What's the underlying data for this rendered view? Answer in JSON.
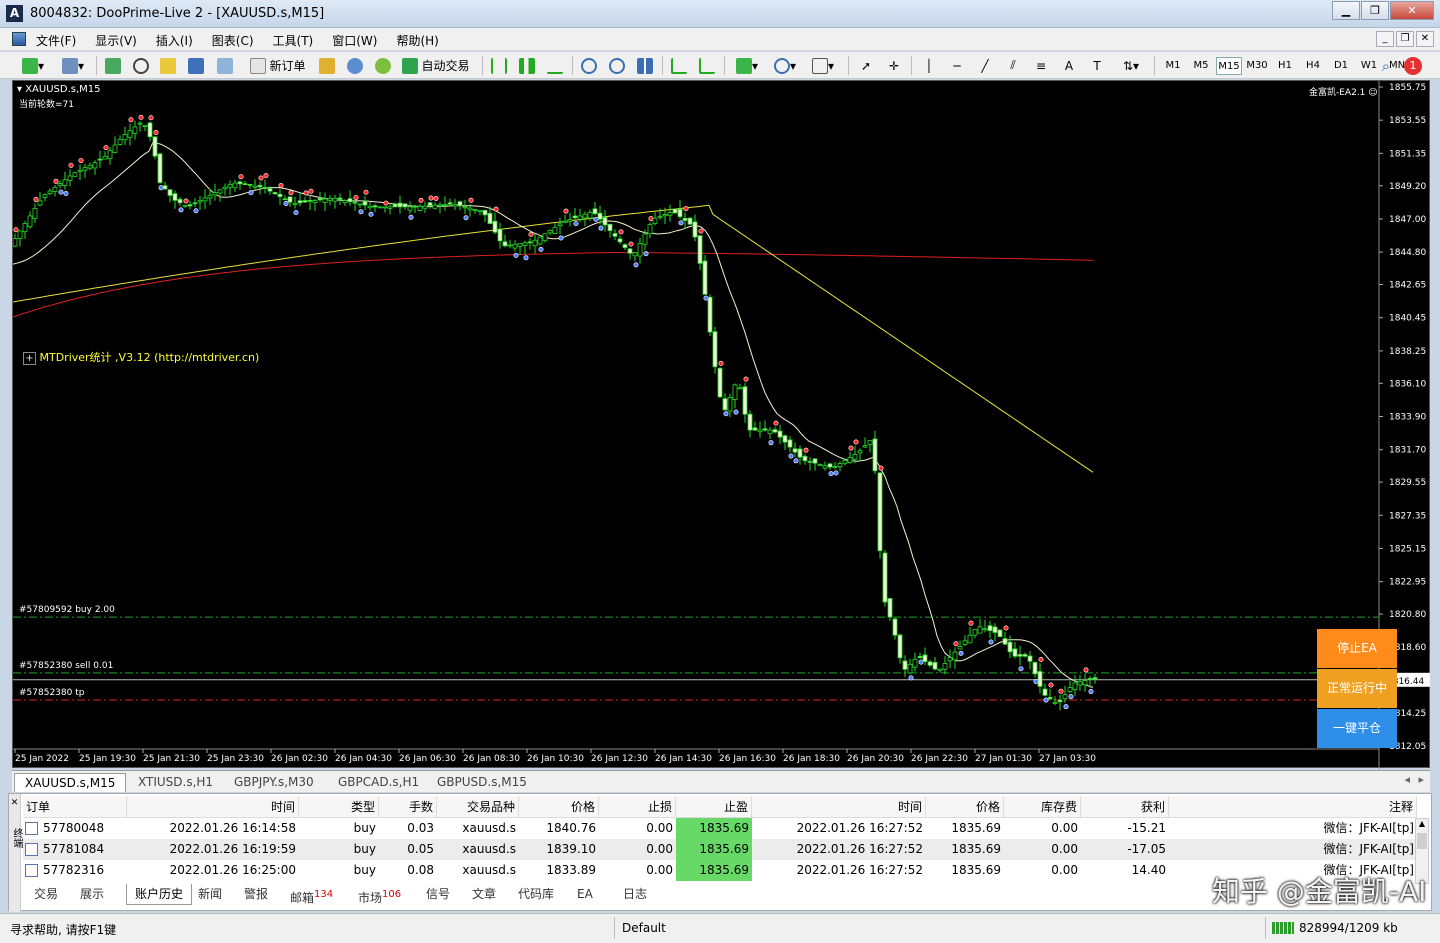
{
  "window": {
    "title": "8004832: DooPrime-Live 2 - [XAUUSD.s,M15]"
  },
  "menu": [
    "文件(F)",
    "显示(V)",
    "插入(I)",
    "图表(C)",
    "工具(T)",
    "窗口(W)",
    "帮助(H)"
  ],
  "toolbar": {
    "new_order": "新订单",
    "auto_trade": "自动交易",
    "timeframes": [
      "M1",
      "M5",
      "M15",
      "M30",
      "H1",
      "H4",
      "D1",
      "W1",
      "MN"
    ],
    "active_timeframe": "M15",
    "notification_count": "1"
  },
  "chart": {
    "symbol_label": "XAUUSD.s,M15",
    "sub_label": "当前轮数=71",
    "ea_label": "金富凯-EA2.1",
    "indicator_label": "MTDriver统计 ,V3.12 (http://mtdriver.cn)",
    "current_price": "1816.44",
    "price_ticks": [
      "1855.75",
      "1853.55",
      "1851.35",
      "1849.20",
      "1847.00",
      "1844.80",
      "1842.65",
      "1840.45",
      "1838.25",
      "1836.10",
      "1833.90",
      "1831.70",
      "1829.55",
      "1827.35",
      "1825.15",
      "1822.95",
      "1820.80",
      "1818.60",
      "1816.44",
      "1814.25",
      "1812.05"
    ],
    "time_ticks": [
      "25 Jan 2022",
      "25 Jan 19:30",
      "25 Jan 21:30",
      "25 Jan 23:30",
      "26 Jan 02:30",
      "26 Jan 04:30",
      "26 Jan 06:30",
      "26 Jan 08:30",
      "26 Jan 10:30",
      "26 Jan 12:30",
      "26 Jan 14:30",
      "26 Jan 16:30",
      "26 Jan 18:30",
      "26 Jan 20:30",
      "26 Jan 22:30",
      "27 Jan 01:30",
      "27 Jan 03:30"
    ],
    "order_lines": [
      {
        "label": "#57809592 buy 2.00",
        "price": 1820.6,
        "color": "#1fa31f"
      },
      {
        "label": "#57852380 sell 0.01",
        "price": 1816.9,
        "color": "#1fa31f"
      },
      {
        "label": "#57852380 tp",
        "price": 1815.1,
        "color": "#e02020"
      }
    ],
    "ea_buttons": {
      "stop": "停止EA",
      "stop_color": "#ff8c1a",
      "running": "正常运行中",
      "running_color": "#f0a020",
      "close_all": "一键平仓",
      "close_all_color": "#2e8ee8"
    }
  },
  "chart_tabs": [
    "XAUUSD.s,M15",
    "XTIUSD.s,H1",
    "GBPJPY.s,M30",
    "GBPCAD.s,H1",
    "GBPUSD.s,M15"
  ],
  "terminal": {
    "columns": [
      "订单",
      "时间",
      "类型",
      "手数",
      "交易品种",
      "价格",
      "止损",
      "止盈",
      "时间",
      "价格",
      "库存费",
      "获利",
      "注释"
    ],
    "rows": [
      [
        "57780048",
        "2022.01.26 16:14:58",
        "buy",
        "0.03",
        "xauusd.s",
        "1840.76",
        "0.00",
        "1835.69",
        "2022.01.26 16:27:52",
        "1835.69",
        "0.00",
        "-15.21",
        "微信：JFK-AI[tp]"
      ],
      [
        "57781084",
        "2022.01.26 16:19:59",
        "buy",
        "0.05",
        "xauusd.s",
        "1839.10",
        "0.00",
        "1835.69",
        "2022.01.26 16:27:52",
        "1835.69",
        "0.00",
        "-17.05",
        "微信：JFK-AI[tp]"
      ],
      [
        "57782316",
        "2022.01.26 16:25:00",
        "buy",
        "0.08",
        "xauusd.s",
        "1833.89",
        "0.00",
        "1835.69",
        "2022.01.26 16:27:52",
        "1835.69",
        "0.00",
        "14.40",
        "微信：JFK-AI[tp]"
      ]
    ],
    "side_label": "终端",
    "tabs": [
      {
        "label": "交易"
      },
      {
        "label": "展示"
      },
      {
        "label": "账户历史",
        "active": true
      },
      {
        "label": "新闻"
      },
      {
        "label": "警报"
      },
      {
        "label": "邮箱",
        "badge": "134"
      },
      {
        "label": "市场",
        "badge": "106"
      },
      {
        "label": "信号"
      },
      {
        "label": "文章"
      },
      {
        "label": "代码库"
      },
      {
        "label": "EA"
      },
      {
        "label": "日志"
      }
    ]
  },
  "status": {
    "help": "寻求帮助, 请按F1键",
    "profile": "Default",
    "traffic": "828994/1209 kb"
  },
  "watermark": "知乎 @金富凯-AI"
}
